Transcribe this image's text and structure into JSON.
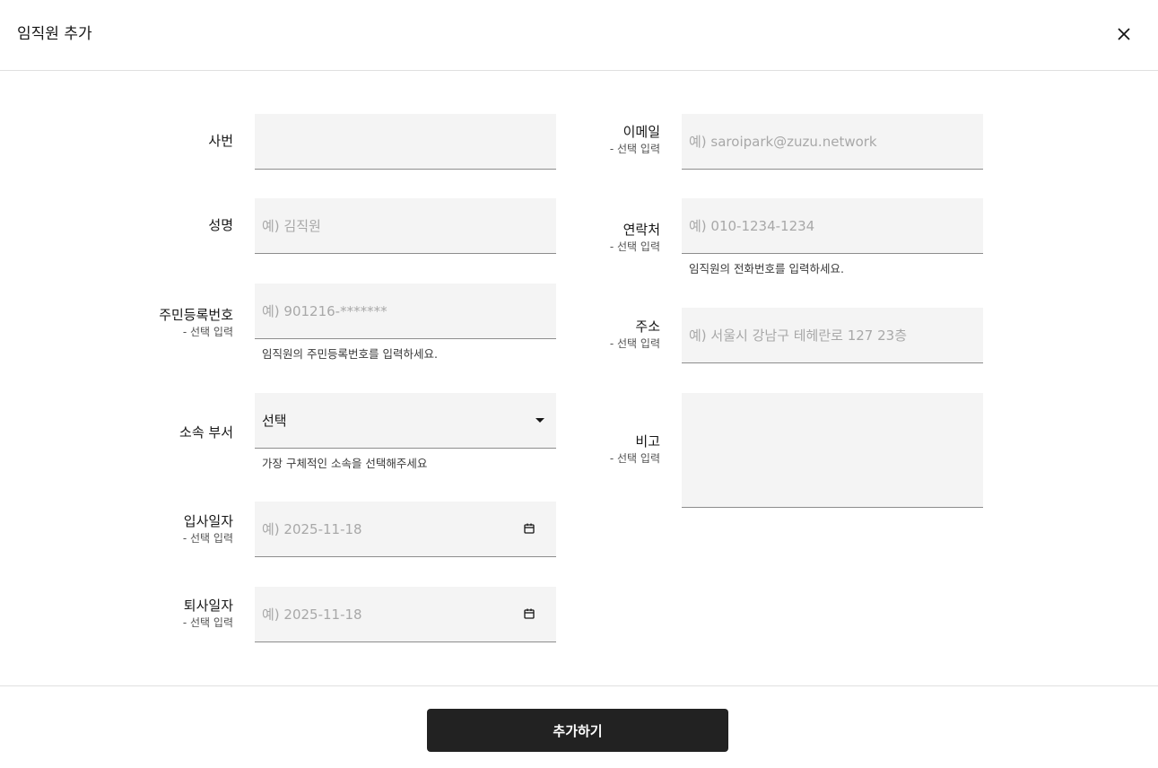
{
  "modal": {
    "title": "임직원 추가"
  },
  "fields": {
    "employee_no": {
      "label": "사번",
      "value": "",
      "placeholder": ""
    },
    "name": {
      "label": "성명",
      "placeholder": "예) 김직원"
    },
    "resident_no": {
      "label": "주민등록번호",
      "sub": "- 선택 입력",
      "placeholder": "예) 901216-*******",
      "helper": "임직원의 주민등록번호를 입력하세요."
    },
    "department": {
      "label": "소속 부서",
      "selected": "선택",
      "helper": "가장 구체적인 소속을 선택해주세요"
    },
    "join_date": {
      "label": "입사일자",
      "sub": "- 선택 입력",
      "placeholder": "예) 2025-11-18"
    },
    "leave_date": {
      "label": "퇴사일자",
      "sub": "- 선택 입력",
      "placeholder": "예) 2025-11-18"
    },
    "email": {
      "label": "이메일",
      "sub": "- 선택 입력",
      "placeholder": "예) saroipark@zuzu.network"
    },
    "phone": {
      "label": "연락처",
      "sub": "- 선택 입력",
      "placeholder": "예) 010-1234-1234",
      "helper": "임직원의 전화번호를 입력하세요."
    },
    "address": {
      "label": "주소",
      "sub": "- 선택 입력",
      "placeholder": "예) 서울시 강남구 테헤란로 127 23층"
    },
    "note": {
      "label": "비고",
      "sub": "- 선택 입력"
    }
  },
  "footer": {
    "submit_label": "추가하기"
  },
  "icons": {
    "close": "close-icon",
    "calendar": "calendar-icon",
    "dropdown": "caret-down-icon"
  },
  "colors": {
    "primary_button": "#222222",
    "field_bg": "#f4f4f4",
    "field_border": "#8d8d8d"
  }
}
